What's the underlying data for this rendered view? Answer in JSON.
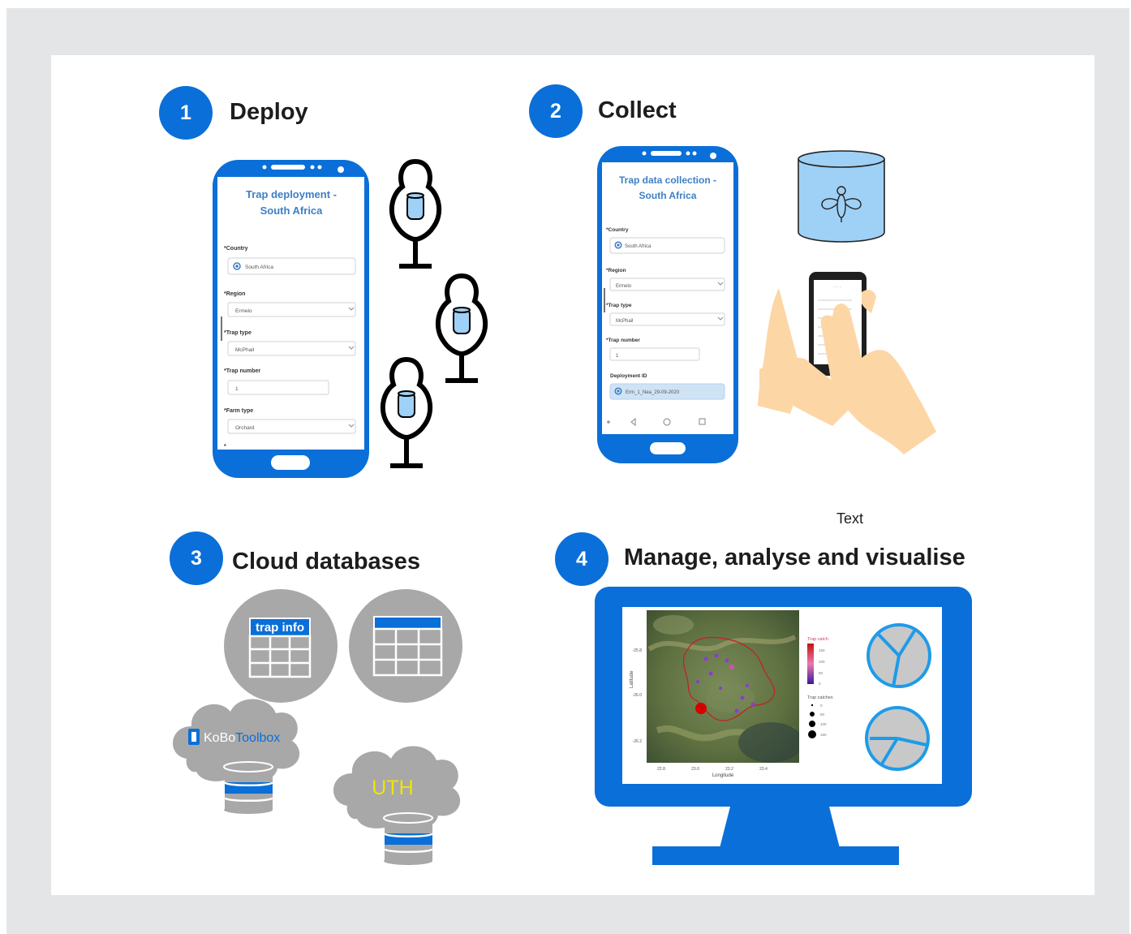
{
  "steps": [
    {
      "number": "1",
      "title": "Deploy"
    },
    {
      "number": "2",
      "title": "Collect"
    },
    {
      "number": "3",
      "title": "Cloud databases"
    },
    {
      "number": "4",
      "title": "Manage, analyse and visualise"
    }
  ],
  "free_text": "Text",
  "deploy_form": {
    "title_line1": "Trap deployment -",
    "title_line2": "South Africa",
    "fields": [
      {
        "label": "Country",
        "value": "South Africa"
      },
      {
        "label": "Region",
        "value": "Ermelo"
      },
      {
        "label": "Trap type",
        "value": "McPhail"
      },
      {
        "label": "Trap number",
        "value": "1"
      },
      {
        "label": "Farm type",
        "value": "Orchard"
      }
    ]
  },
  "collect_form": {
    "title_line1": "Trap data collection -",
    "title_line2": "South Africa",
    "fields": [
      {
        "label": "Country",
        "value": "South Africa"
      },
      {
        "label": "Region",
        "value": "Ermelo"
      },
      {
        "label": "Trap type",
        "value": "McPhail"
      },
      {
        "label": "Trap number",
        "value": "1"
      }
    ],
    "deployment_label": "Deployment ID",
    "deployment_value": "Erm_1_Nea_29-09-2020"
  },
  "databases": {
    "table_label": "trap info",
    "kobo_prefix": "KoBo",
    "kobo_suffix": "Toolbox",
    "uth_label": "UTH"
  },
  "map_plot": {
    "ylabel": "Latitude",
    "xlabel": "Longitude",
    "y_ticks": [
      "-25.8",
      "-26.0",
      "-26.2"
    ],
    "x_ticks": [
      "22.8",
      "23.0",
      "23.2",
      "23.4"
    ],
    "legend1_title": "Trap catch",
    "legend1_ticks": [
      "150",
      "100",
      "50",
      "0"
    ],
    "legend2_title": "Trap catches",
    "legend2_items": [
      "0",
      "50",
      "100",
      "150"
    ]
  },
  "colors": {
    "accent": "#0a6fd8",
    "grey": "#a8a8a8",
    "light_blue": "#9fd0f5",
    "pie_grey": "#c8c8c8",
    "uth_text": "#f2e400"
  }
}
